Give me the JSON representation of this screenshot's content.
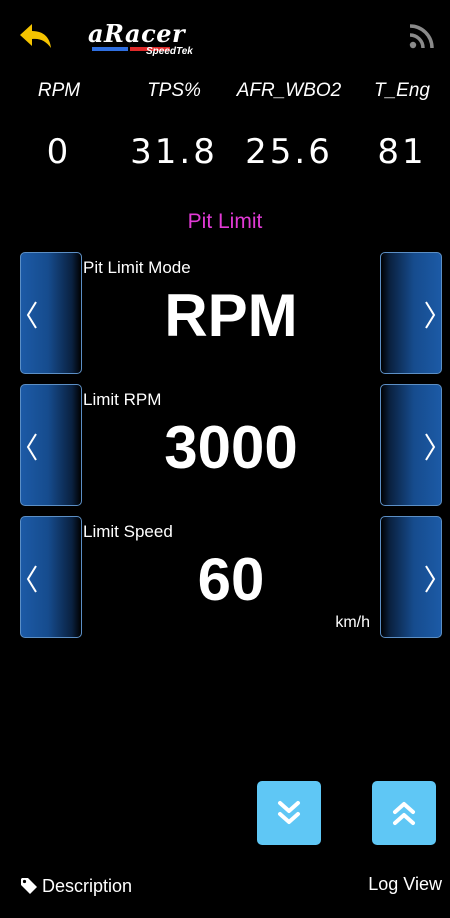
{
  "header": {
    "back_icon": "back-arrow-icon",
    "brand_name": "aRacer",
    "brand_sub": "SpeedTek",
    "signal_icon": "signal-icon",
    "back_color": "#f5c400"
  },
  "gauges": [
    {
      "label": "RPM",
      "value": "0"
    },
    {
      "label": "TPS%",
      "value": "31.8"
    },
    {
      "label": "AFR_WBO2",
      "value": "25.6"
    },
    {
      "label": "T_Eng",
      "value": "81"
    }
  ],
  "section_title": "Pit Limit",
  "settings": [
    {
      "label": "Pit Limit Mode",
      "value": "RPM",
      "unit": ""
    },
    {
      "label": "Limit RPM",
      "value": "3000",
      "unit": ""
    },
    {
      "label": "Limit Speed",
      "value": "60",
      "unit": "km/h"
    }
  ],
  "bottom": {
    "description_label": "Description",
    "log_view_label": "Log View",
    "scroll_down_icon": "double-chevron-down-icon",
    "scroll_up_icon": "double-chevron-up-icon"
  },
  "colors": {
    "accent_title": "#e23ad6",
    "button_blue": "#1c5aa6",
    "scroll_button": "#5fc7f5"
  }
}
